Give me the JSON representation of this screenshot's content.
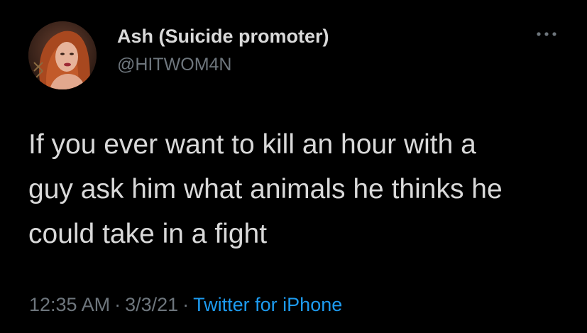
{
  "author": {
    "display_name": "Ash (Suicide promoter)",
    "handle": "@HITWOM4N",
    "avatar_icon": "profile-photo"
  },
  "tweet": {
    "lines": [
      "If you ever want to kill an hour with a",
      "guy ask him what animals he thinks he",
      "could take in a fight"
    ],
    "time": "12:35 AM",
    "separator": "·",
    "date": "3/3/21",
    "source": "Twitter for iPhone"
  },
  "colors": {
    "background": "#000000",
    "text": "#d9d9d9",
    "secondary": "#6e767d",
    "link": "#1d9bf0"
  },
  "icons": {
    "more": "more-horizontal-icon"
  }
}
